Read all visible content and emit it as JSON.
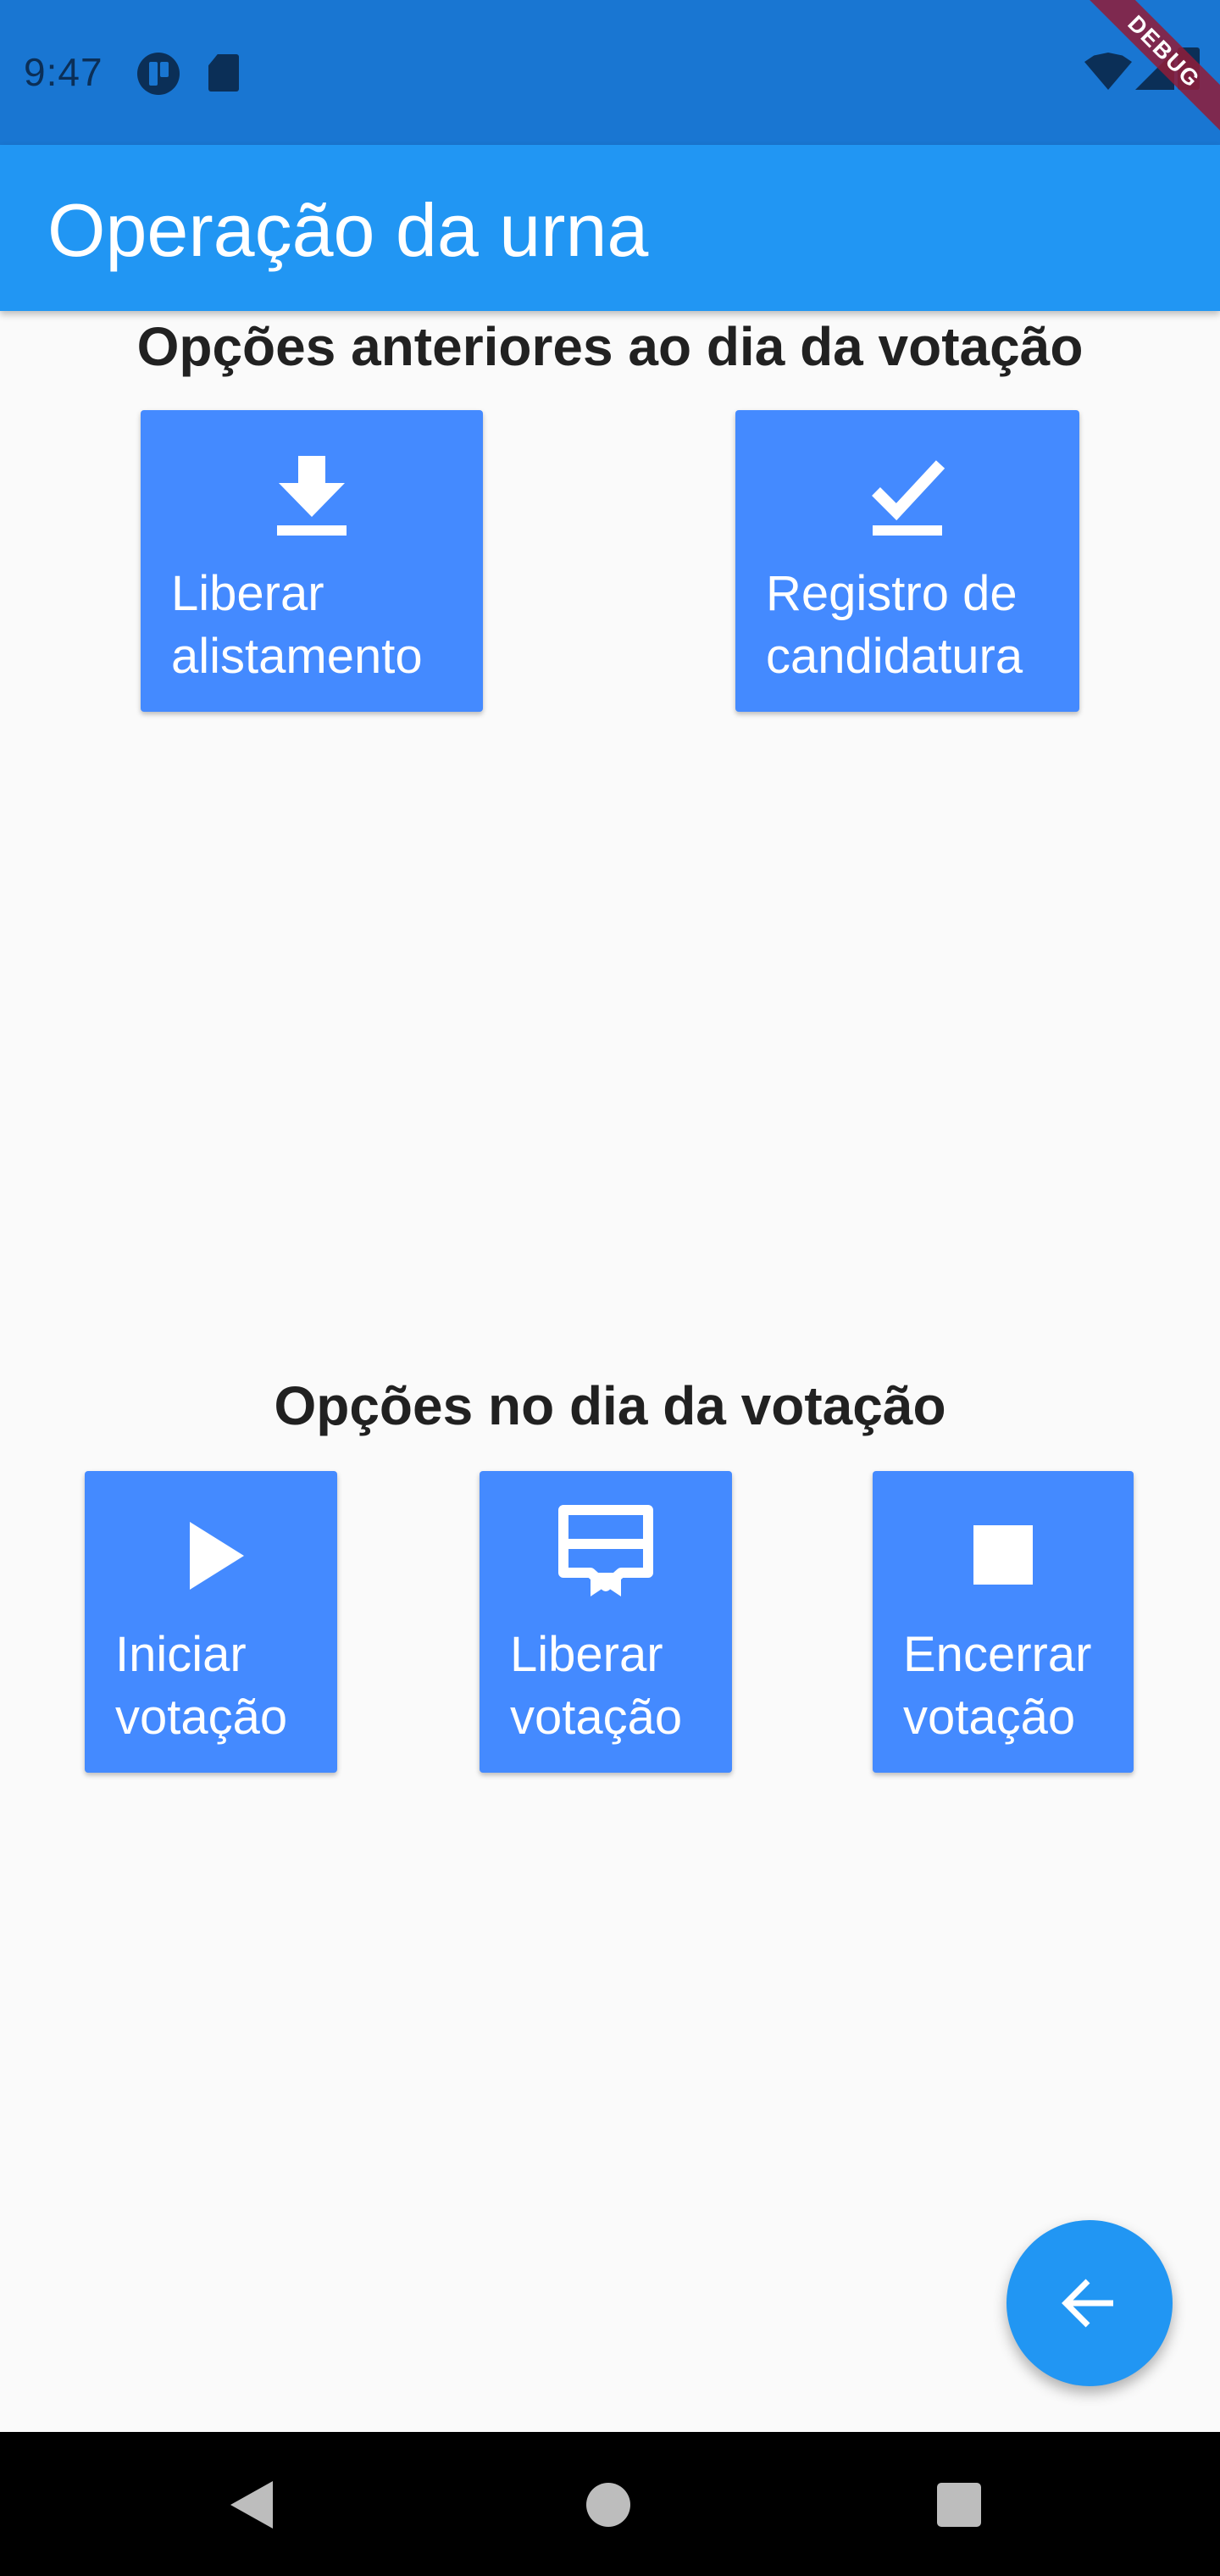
{
  "status_bar": {
    "time": "9:47",
    "icons": [
      "app-notification-icon",
      "sd-card-icon",
      "wifi-icon",
      "signal-icon",
      "battery-icon"
    ]
  },
  "debug_banner": "DEBUG",
  "app_bar": {
    "title": "Operação da urna",
    "color": "#2196f3"
  },
  "sections": [
    {
      "title": "Opções anteriores ao dia da votação",
      "buttons": [
        {
          "label": "Liberar\nalistamento",
          "icon": "download-icon"
        },
        {
          "label": "Registro de\ncandidatura",
          "icon": "check-icon"
        }
      ]
    },
    {
      "title": "Opções no dia da votação",
      "buttons": [
        {
          "label": "Iniciar\nvotação",
          "icon": "play-icon"
        },
        {
          "label": "Liberar\nvotação",
          "icon": "card-membership-icon"
        },
        {
          "label": "Encerrar\nvotação",
          "icon": "stop-icon"
        }
      ]
    }
  ],
  "fab": {
    "icon": "arrow-back-icon"
  },
  "nav_bar": {
    "icons": [
      "nav-back-icon",
      "nav-home-icon",
      "nav-recents-icon"
    ]
  },
  "colors": {
    "status_bar": "#1976d2",
    "tile": "#448aff",
    "background": "#fafafa"
  }
}
